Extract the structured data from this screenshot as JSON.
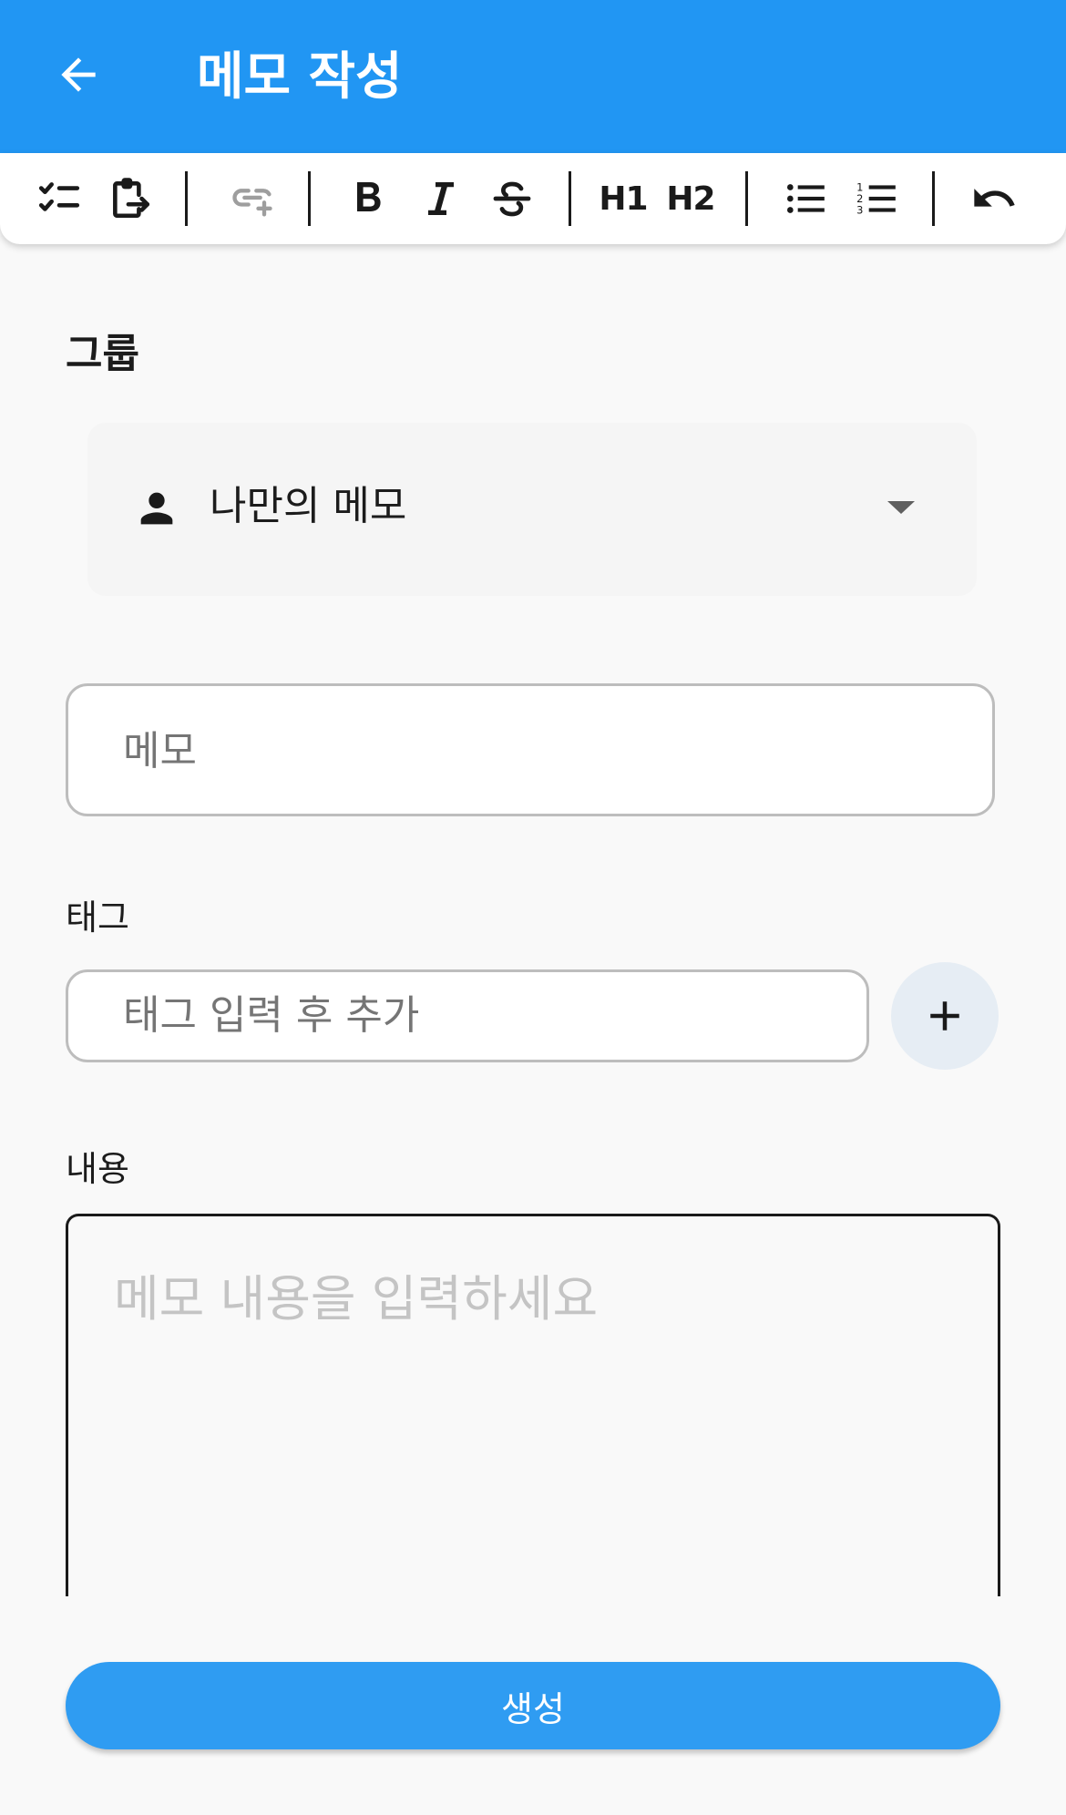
{
  "appbar": {
    "title": "메모 작성",
    "back_icon": "arrow-back-icon",
    "color": "#2196f3"
  },
  "toolbar": {
    "items": [
      {
        "name": "checklist-icon"
      },
      {
        "name": "paste-icon"
      },
      {
        "name": "link-icon",
        "disabled": true
      },
      {
        "name": "bold-icon"
      },
      {
        "name": "italic-icon"
      },
      {
        "name": "strikethrough-icon"
      },
      {
        "name": "heading1",
        "label": "H1"
      },
      {
        "name": "heading2",
        "label": "H2"
      },
      {
        "name": "bullet-list-icon"
      },
      {
        "name": "numbered-list-icon"
      },
      {
        "name": "undo-icon"
      }
    ],
    "h1_label": "H1",
    "h2_label": "H2"
  },
  "group": {
    "label": "그룹",
    "selected": "나만의 메모",
    "icon": "person-icon"
  },
  "memo_title": {
    "placeholder": "메모"
  },
  "tags": {
    "label": "태그",
    "placeholder": "태그 입력 후 추가",
    "add_icon": "plus-icon"
  },
  "content": {
    "label": "내용",
    "placeholder": "메모 내용을 입력하세요"
  },
  "submit": {
    "label": "생성",
    "color": "#2f9cf2"
  }
}
